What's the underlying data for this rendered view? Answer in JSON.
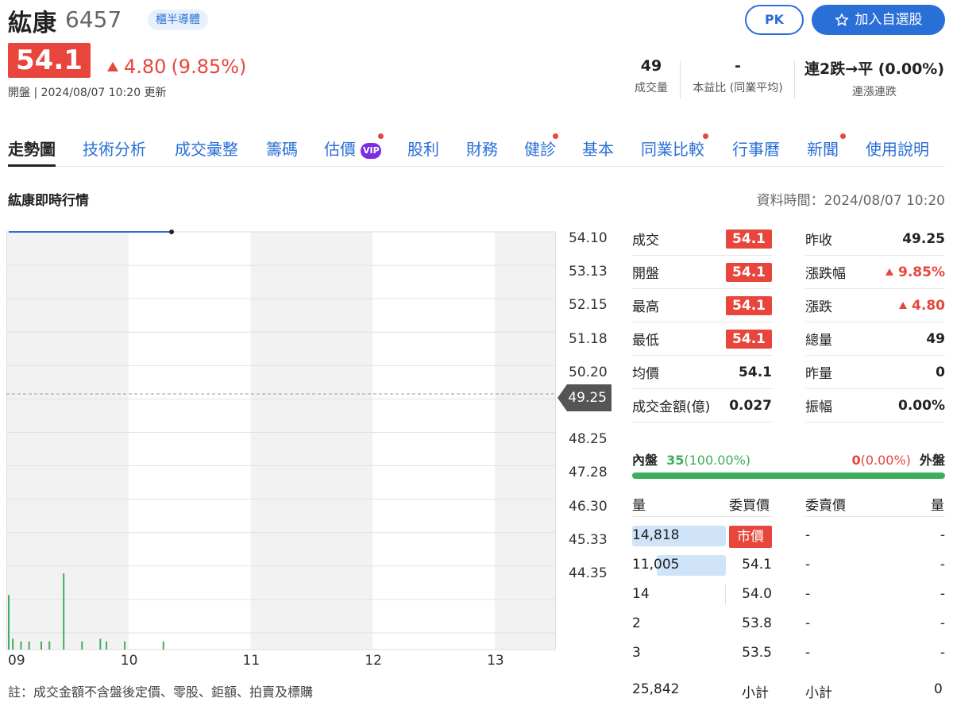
{
  "stock": {
    "name": "紘康",
    "code": "6457",
    "sector": "櫃半導體",
    "price": "54.1",
    "change": "4.80",
    "change_pct": "(9.85%)",
    "status": "開盤 | 2024/08/07 10:20 更新",
    "pk_label": "PK",
    "watchlist_label": "加入自選股"
  },
  "summary": [
    {
      "value": "49",
      "label": "成交量"
    },
    {
      "value": "-",
      "label": "本益比 (同業平均)"
    },
    {
      "value": "連2跌→平 (0.00%)",
      "label": "連漲連跌"
    }
  ],
  "tabs": [
    {
      "label": "走勢圖"
    },
    {
      "label": "技術分析"
    },
    {
      "label": "成交彙整"
    },
    {
      "label": "籌碼"
    },
    {
      "label": "估價",
      "badge": "VIP"
    },
    {
      "label": "股利"
    },
    {
      "label": "財務"
    },
    {
      "label": "健診"
    },
    {
      "label": "基本"
    },
    {
      "label": "同業比較"
    },
    {
      "label": "行事曆"
    },
    {
      "label": "新聞"
    },
    {
      "label": "使用說明"
    }
  ],
  "section": {
    "title": "紘康即時行情",
    "data_time": "資料時間：2024/08/07 10:20"
  },
  "chart_data": {
    "type": "line",
    "title": "",
    "xlabel": "",
    "ylabel": "",
    "x_ticks": [
      "09",
      "10",
      "11",
      "12",
      "13"
    ],
    "y_ticks": [
      "54.10",
      "53.13",
      "52.15",
      "51.18",
      "50.20",
      "49.25",
      "48.25",
      "47.28",
      "46.30",
      "45.33",
      "44.35"
    ],
    "ylim": [
      44.35,
      54.1
    ],
    "reference_price": "49.25",
    "series": [
      {
        "x": [
          "09:00",
          "10:20"
        ],
        "values": [
          54.1,
          54.1
        ]
      }
    ],
    "volume_bars": [
      20,
      4,
      3,
      3,
      3,
      3,
      28,
      3,
      4,
      3,
      3,
      3
    ],
    "volume_times": [
      "09:00",
      "09:02",
      "09:06",
      "09:10",
      "09:16",
      "09:20",
      "09:27",
      "09:36",
      "09:45",
      "09:48",
      "09:57",
      "10:16"
    ],
    "grid": true
  },
  "quotes_left": [
    {
      "label": "成交",
      "value": "54.1",
      "style": "pill"
    },
    {
      "label": "開盤",
      "value": "54.1",
      "style": "pill"
    },
    {
      "label": "最高",
      "value": "54.1",
      "style": "pill"
    },
    {
      "label": "最低",
      "value": "54.1",
      "style": "pill"
    },
    {
      "label": "均價",
      "value": "54.1",
      "style": "plain"
    },
    {
      "label": "成交金額(億)",
      "value": "0.027",
      "style": "plain"
    }
  ],
  "quotes_right": [
    {
      "label": "昨收",
      "value": "49.25",
      "style": "plain"
    },
    {
      "label": "漲跌幅",
      "value": "9.85%",
      "style": "up"
    },
    {
      "label": "漲跌",
      "value": "4.80",
      "style": "up"
    },
    {
      "label": "總量",
      "value": "49",
      "style": "plain"
    },
    {
      "label": "昨量",
      "value": "0",
      "style": "plain"
    },
    {
      "label": "振幅",
      "value": "0.00%",
      "style": "plain"
    }
  ],
  "flow": {
    "inner_label": "內盤",
    "inner_value": "35",
    "inner_pct": "(100.00%)",
    "outer_value": "0",
    "outer_pct": "(0.00%)",
    "outer_label": "外盤",
    "inner_ratio": 1.0
  },
  "orderbook": {
    "headers": [
      "量",
      "委買價",
      "委賣價",
      "量"
    ],
    "rows": [
      {
        "bid_vol": "14,818",
        "bid_price": "市價",
        "ask_price": "-",
        "ask_vol": "-",
        "bar": 1.0
      },
      {
        "bid_vol": "11,005",
        "bid_price": "54.1",
        "ask_price": "-",
        "ask_vol": "-",
        "bar": 0.74
      },
      {
        "bid_vol": "14",
        "bid_price": "54.0",
        "ask_price": "-",
        "ask_vol": "-",
        "bar": 0.0
      },
      {
        "bid_vol": "2",
        "bid_price": "53.8",
        "ask_price": "-",
        "ask_vol": "-",
        "bar": 0.0
      },
      {
        "bid_vol": "3",
        "bid_price": "53.5",
        "ask_price": "-",
        "ask_vol": "-",
        "bar": 0.0
      }
    ],
    "totals": {
      "bid_vol": "25,842",
      "bid_label": "小計",
      "ask_label": "小計",
      "ask_vol": "0"
    }
  },
  "footnote": "註：成交金額不含盤後定價、零股、鉅額、拍賣及標購",
  "colors": {
    "up": "#e8463d",
    "accent": "#2a6fd8",
    "inner": "#3cae5c"
  }
}
